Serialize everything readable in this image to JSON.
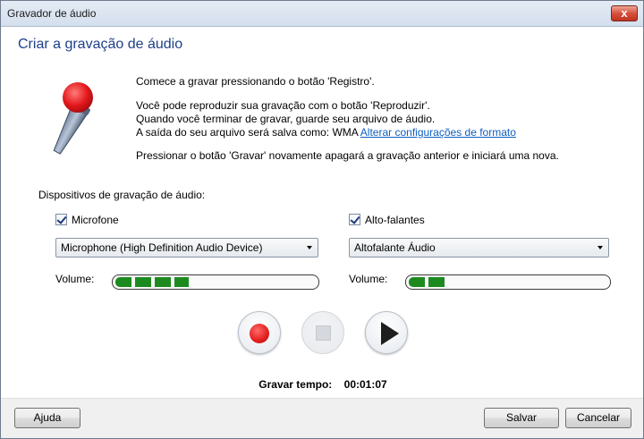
{
  "window": {
    "title": "Gravador de áudio",
    "close_glyph": "x"
  },
  "heading": "Criar a gravação de áudio",
  "intro": {
    "line1": "Comece a gravar pressionando o botão 'Registro'.",
    "line2": "Você pode reproduzir sua gravação com o botão 'Reproduzir'.",
    "line3": "Quando você terminar de gravar, guarde seu arquivo de áudio.",
    "line4_prefix": "A saída do seu arquivo será salva como: WMA",
    "line4_link": "Alterar configurações de formato",
    "line5": "Pressionar o botão 'Gravar' novamente apagará a gravação anterior e iniciará uma nova."
  },
  "devices": {
    "label": "Dispositivos de gravação de áudio:",
    "volume_label": "Volume:",
    "microphone": {
      "checkbox_label": "Microfone",
      "checked": true,
      "selected": "Microphone (High Definition Audio Device)",
      "volume_level": 0.37
    },
    "speakers": {
      "checkbox_label": "Alto-falantes",
      "checked": true,
      "selected": "Altofalante Áudio",
      "volume_level": 0.2
    }
  },
  "controls": {
    "record_icon": "record-icon",
    "stop_icon": "stop-icon",
    "play_icon": "play-icon"
  },
  "timer": {
    "label": "Gravar tempo:",
    "value": "00:01:07"
  },
  "footer": {
    "help": "Ajuda",
    "save": "Salvar",
    "cancel": "Cancelar"
  },
  "colors": {
    "heading": "#1e3f8a",
    "link": "#0f5fc1",
    "meter": "#1d8a1f",
    "record": "#e21d1d"
  }
}
